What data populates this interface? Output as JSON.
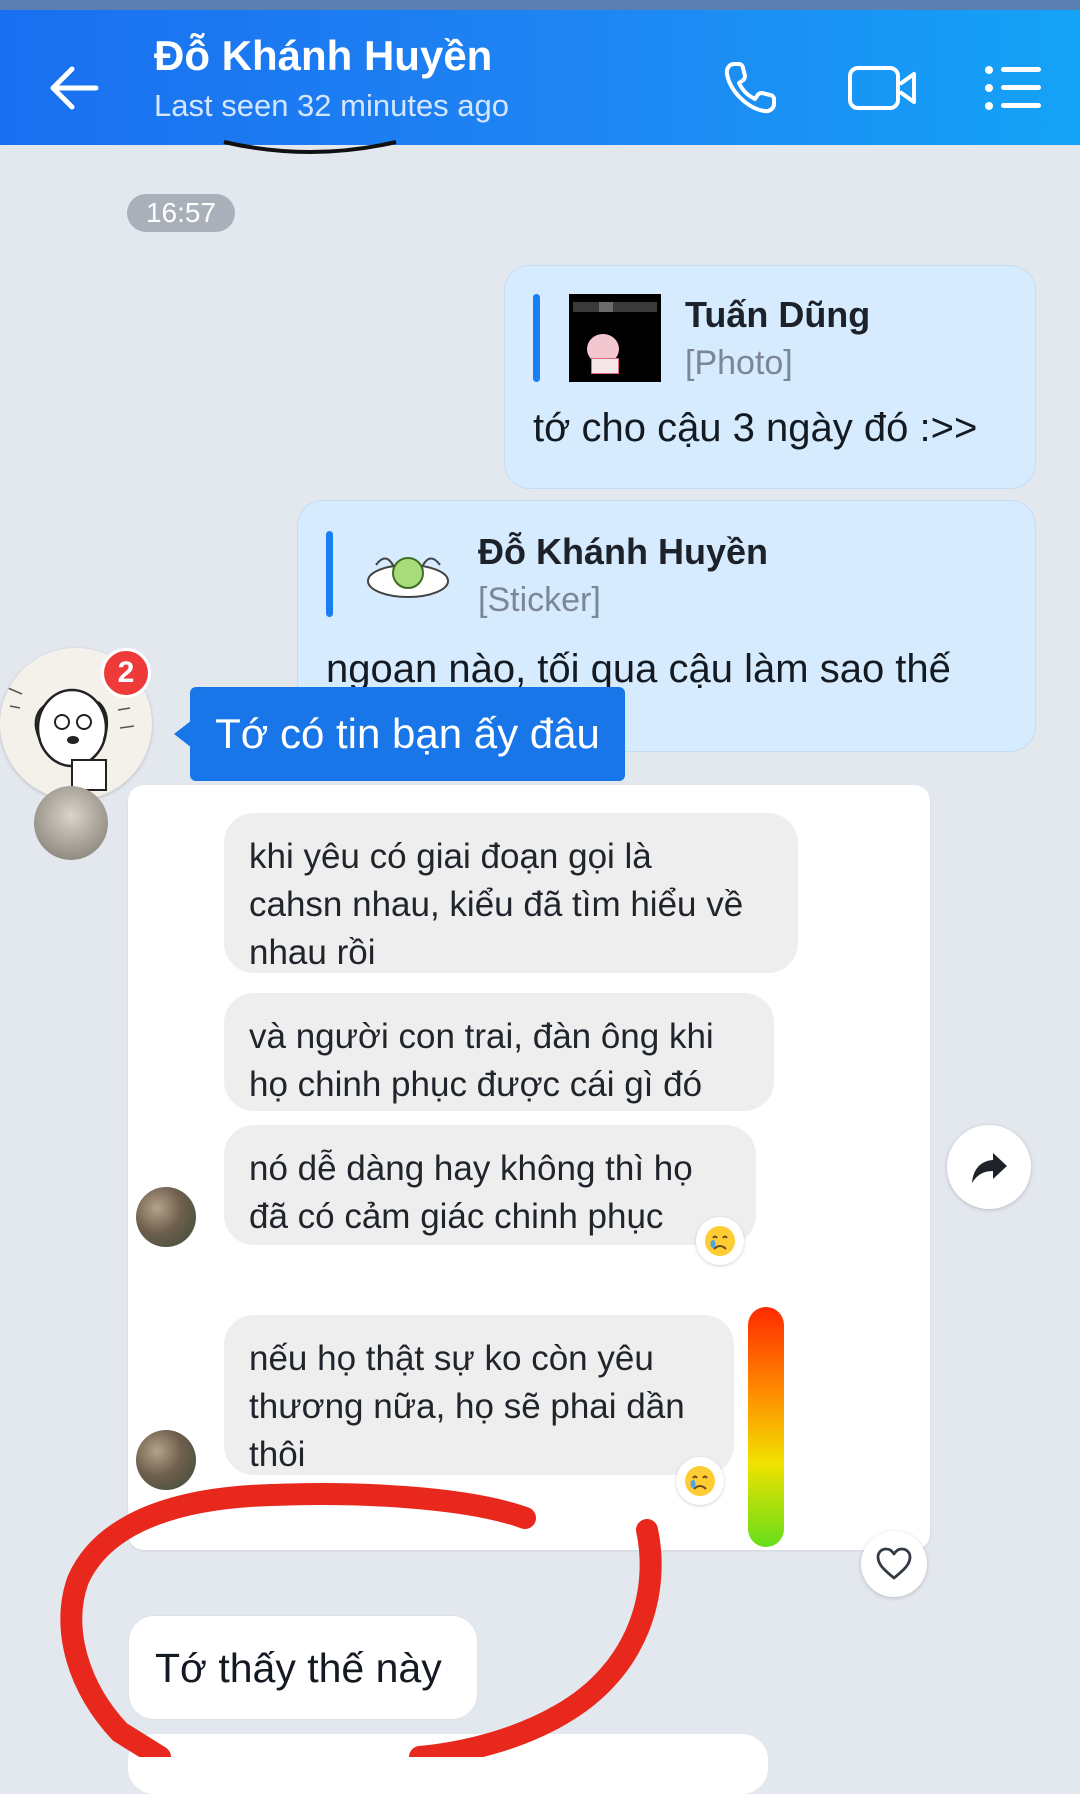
{
  "header": {
    "contact_name": "Đỗ Khánh Huyền",
    "status": "Last seen 32 minutes ago",
    "back_icon": "arrow-left-icon",
    "call_icon": "phone-icon",
    "video_icon": "video-camera-icon",
    "menu_icon": "list-menu-icon"
  },
  "chat": {
    "timestamp": "16:57",
    "messages": [
      {
        "quote_name": "Tuấn Dũng",
        "quote_type": "[Photo]",
        "text": "tớ cho cậu 3 ngày đó :>>"
      },
      {
        "quote_name": "Đỗ Khánh Huyền",
        "quote_type": "[Sticker]",
        "text": "ngoan nào, tối qua cậu làm sao thế"
      }
    ],
    "unread_badge": "2",
    "tooltip_text": "Tớ có tin bạn ấy đâu",
    "embedded": {
      "bubbles": [
        {
          "lines": [
            "khi yêu có giai đoạn gọi là",
            "cahsn nhau, kiểu đã tìm hiểu về",
            "nhau rồi"
          ]
        },
        {
          "lines": [
            "và người con trai, đàn ông khi",
            "họ chinh phục được cái gì đó"
          ]
        },
        {
          "lines": [
            "nó dễ dàng hay không thì họ",
            "đã có cảm giác chinh phục"
          ]
        },
        {
          "lines": [
            "nếu họ thật sự ko còn yêu",
            "thương nữa, họ sẽ phai dần",
            "thôi"
          ]
        }
      ],
      "reaction_icon": "crying-face-icon"
    },
    "incoming_text": "Tớ thấy thế này",
    "forward_icon": "forward-arrow-icon",
    "heart_icon": "heart-outline-icon"
  },
  "colors": {
    "header_start": "#1a6ff0",
    "header_end": "#14a3f7",
    "outgoing_bubble": "#d6ebfd",
    "quote_bar": "#1a7ff2",
    "tooltip": "#1976e8",
    "badge": "#ef3a3a",
    "annotation_circle": "#e8281c"
  }
}
